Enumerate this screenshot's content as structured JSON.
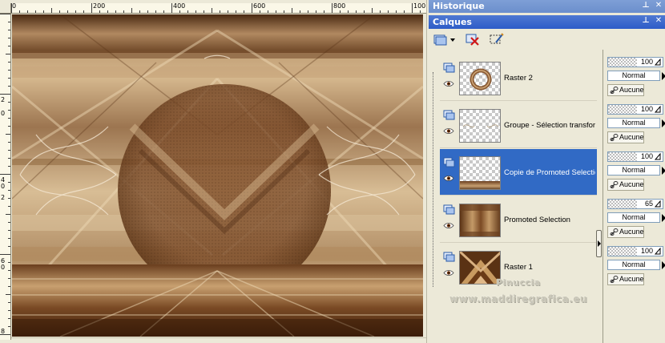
{
  "ruler": {
    "h_labels": [
      "0",
      "200",
      "400",
      "600",
      "800",
      "100"
    ],
    "v_labels": [
      "2",
      "0",
      "4",
      "0",
      "2",
      "6",
      "0",
      "8"
    ]
  },
  "panels": {
    "history_title": "Historique",
    "layers_title": "Calques"
  },
  "toolbar": {
    "new_layer_icon": "new-raster-layer-icon",
    "delete_icon": "delete-layer-icon",
    "edit_icon": "edit-selection-icon"
  },
  "layers": [
    {
      "name": "Raster 2",
      "opacity": "100",
      "blend": "Normal",
      "mask": "Aucune",
      "selected": false,
      "thumb": "ring"
    },
    {
      "name": "Groupe - Sélection transformée",
      "opacity": "100",
      "blend": "Normal",
      "mask": "Aucune",
      "selected": false,
      "thumb": "group"
    },
    {
      "name": "Copie de Promoted Selection",
      "opacity": "100",
      "blend": "Normal",
      "mask": "Aucune",
      "selected": true,
      "thumb": "floor"
    },
    {
      "name": "Promoted Selection",
      "opacity": "65",
      "blend": "Normal",
      "mask": "Aucune",
      "selected": false,
      "thumb": "promoted"
    },
    {
      "name": "Raster 1",
      "opacity": "100",
      "blend": "Normal",
      "mask": "Aucune",
      "selected": false,
      "thumb": "raster"
    }
  ],
  "watermark": {
    "line1": "Pinuccia",
    "line2": "www.maddiregrafica.eu"
  },
  "colors": {
    "selection": "#316ac5",
    "titlebar_active": "#2d5cc8",
    "titlebar_inactive": "#7e9fd6",
    "canvas_dark": "#5a3318",
    "canvas_light": "#c8a97a"
  }
}
